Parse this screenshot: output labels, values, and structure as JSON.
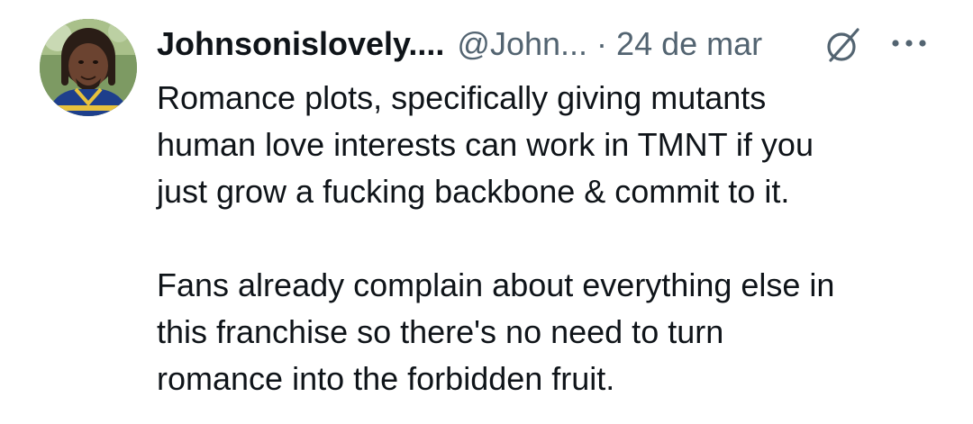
{
  "tweet": {
    "display_name": "Johnsonislovely....",
    "handle": "@John...",
    "separator": "·",
    "date": "24 de mar",
    "paragraph1_lines": [
      "Romance plots, specifically giving mutants",
      "human love interests can work in TMNT if you",
      "just grow a fucking backbone & commit to it."
    ],
    "paragraph2_lines": [
      "Fans already complain about everything else in",
      "this franchise so there's no need to turn",
      "romance into the forbidden fruit."
    ]
  },
  "icons": {
    "avatar": "user-avatar",
    "grok": "grok-icon",
    "more": "more-options-icon"
  },
  "colors": {
    "text_primary": "#0f1419",
    "text_secondary": "#536471",
    "background": "#ffffff"
  }
}
